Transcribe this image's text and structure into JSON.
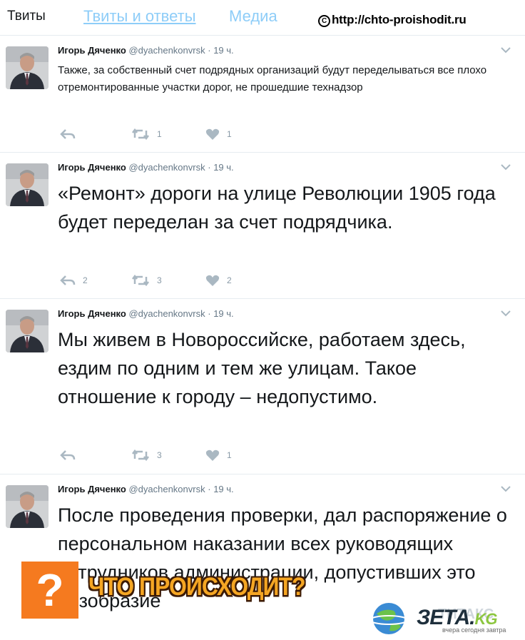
{
  "tabs": [
    {
      "label": "Твиты"
    },
    {
      "label": "Твиты и ответы"
    },
    {
      "label": "Медиа"
    }
  ],
  "watermark": "http://chto-proishodit.ru",
  "tweets": [
    {
      "name": "Игорь Дяченко",
      "handle": "@dyachenkonvrsk",
      "dot": "·",
      "time": "19 ч.",
      "text": "Также, за собственный счет подрядных организаций будут переделываться все плохо отремонтированные участки дорог,  не прошедшие технадзор",
      "replies": "",
      "retweets": "1",
      "likes": "1"
    },
    {
      "name": "Игорь Дяченко",
      "handle": "@dyachenkonvrsk",
      "dot": "·",
      "time": "19 ч.",
      "text": "«Ремонт» дороги на улице Революции 1905 года будет переделан за счет подрядчика.",
      "replies": "2",
      "retweets": "3",
      "likes": "2"
    },
    {
      "name": "Игорь Дяченко",
      "handle": "@dyachenkonvrsk",
      "dot": "·",
      "time": "19 ч.",
      "text": "Мы живем в Новороссийске, работаем здесь, ездим по одним и тем же улицам. Такое отношение к городу – недопустимо.",
      "replies": "",
      "retweets": "3",
      "likes": "1"
    },
    {
      "name": "Игорь Дяченко",
      "handle": "@dyachenkonvrsk",
      "dot": "·",
      "time": "19 ч.",
      "text": "После проведения  проверки, дал распоряжение о персональном наказании всех руководящих сотрудников администрации, допустивших это безобразие"
    }
  ],
  "overlay": {
    "question_mark": "?",
    "title": "ЧТО ПРОИСХОДИТ?",
    "logo_text": "ЗЕТА.",
    "logo_suffix": "KG",
    "logo_faint": "ТИТАКС",
    "logo_sub": "вчера сегодня завтра"
  },
  "colors": {
    "text": "#14171a",
    "muted": "#657786",
    "icon": "#8899a6",
    "tab_link": "#8ecdf8",
    "border": "#e6ecf0",
    "orange": "#f57a1f"
  }
}
